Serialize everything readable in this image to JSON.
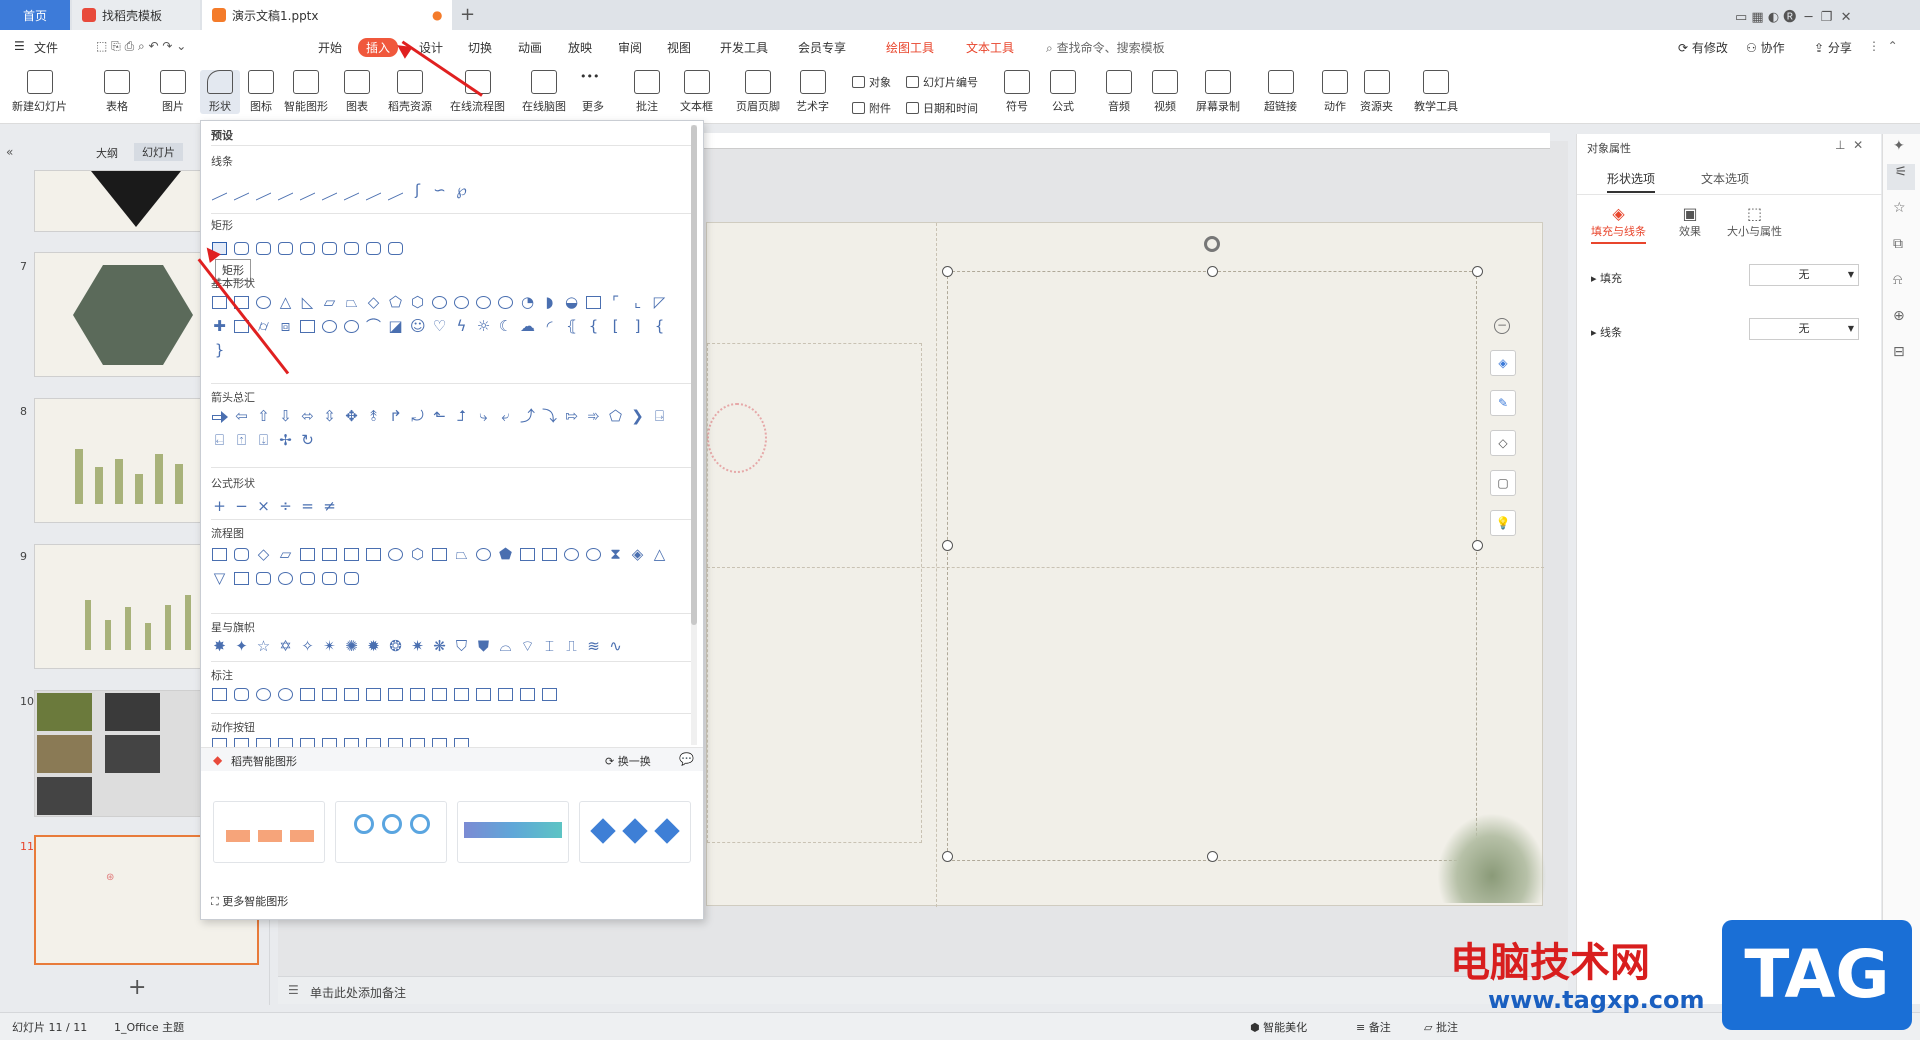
{
  "tabs": {
    "home": "首页",
    "template": "找稻壳模板",
    "doc": "演示文稿1.pptx"
  },
  "menu": {
    "file": "文件",
    "items": [
      "开始",
      "插入",
      "设计",
      "切换",
      "动画",
      "放映",
      "审阅",
      "视图",
      "开发工具",
      "会员专享"
    ],
    "active": "插入",
    "tools": [
      "绘图工具",
      "文本工具"
    ],
    "search": "查找命令、搜索模板",
    "right": [
      "有修改",
      "协作",
      "分享"
    ]
  },
  "toolbar": {
    "buttons": [
      "新建幻灯片",
      "表格",
      "图片",
      "形状",
      "图标",
      "智能图形",
      "图表",
      "稻壳资源",
      "在线流程图",
      "在线脑图",
      "更多",
      "批注",
      "文本框",
      "页眉页脚",
      "艺术字",
      "符号",
      "公式",
      "音频",
      "视频",
      "屏幕录制",
      "超链接",
      "动作",
      "资源夹",
      "教学工具"
    ],
    "small": [
      "对象",
      "幻灯片编号",
      "附件",
      "日期和时间"
    ]
  },
  "leftpane": {
    "outline": "大纲",
    "slides": "幻灯片",
    "numbers": [
      "7",
      "8",
      "9",
      "10",
      "11"
    ],
    "add": "+"
  },
  "shapes_panel": {
    "preset": "预设",
    "sections": [
      "线条",
      "矩形",
      "基本形状",
      "箭头总汇",
      "公式形状",
      "流程图",
      "星与旗帜",
      "标注",
      "动作按钮"
    ],
    "tooltip": "矩形",
    "smart_title": "稻壳智能图形",
    "swap": "换一换",
    "more": "更多智能图形"
  },
  "right_panel": {
    "title": "对象属性",
    "tabs": [
      "形状选项",
      "文本选项"
    ],
    "subtabs": [
      "填充与线条",
      "效果",
      "大小与属性"
    ],
    "fill_label": "填充",
    "fill_value": "无",
    "line_label": "线条",
    "line_value": "无"
  },
  "notes": {
    "placeholder": "单击此处添加备注"
  },
  "status": {
    "slide": "幻灯片 11 / 11",
    "theme": "1_Office 主题",
    "beautify": "智能美化",
    "notes": "备注",
    "comment": "批注"
  },
  "watermark": {
    "site": "电脑技术网",
    "url": "www.tagxp.com",
    "tag": "TAG"
  },
  "colors": {
    "accent": "#f0583c",
    "blue": "#3d7bd9",
    "arrow": "#e02020"
  }
}
